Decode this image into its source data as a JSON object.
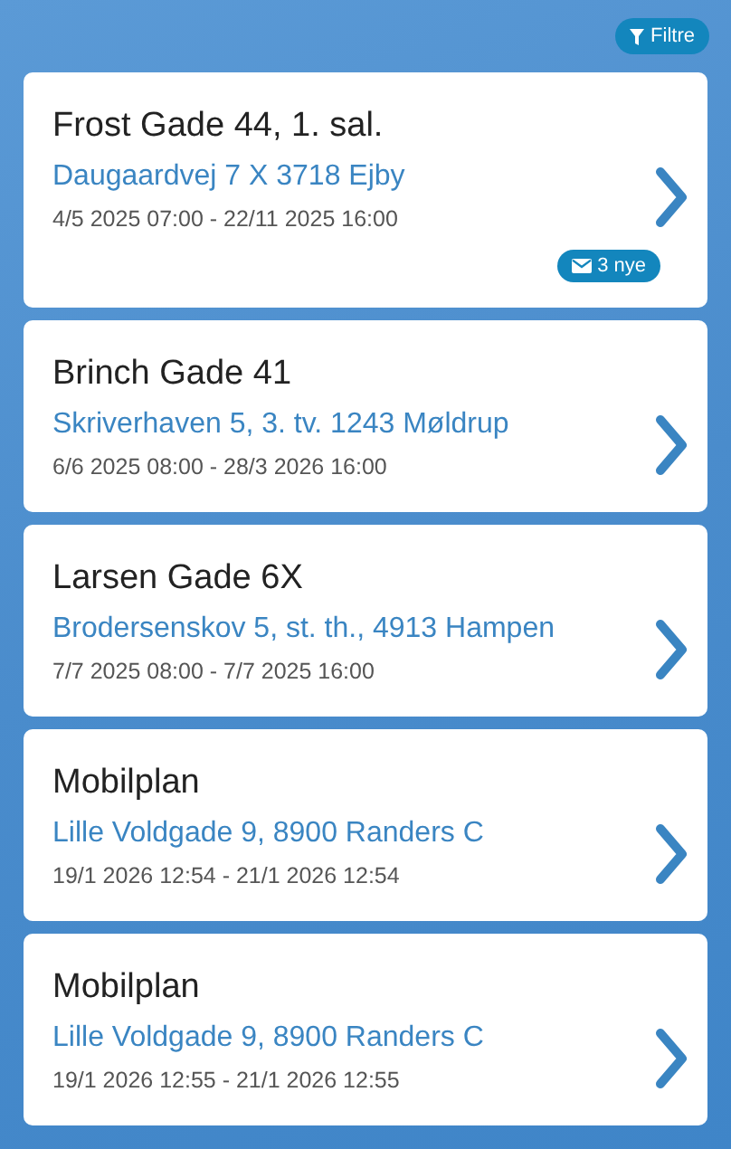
{
  "filter_button": {
    "label": "Filtre"
  },
  "cards": [
    {
      "title": "Frost Gade 44, 1. sal.",
      "address": "Daugaardvej 7 X 3718 Ejby",
      "period": "4/5 2025 07:00 - 22/11 2025 16:00",
      "badge": "3 nye"
    },
    {
      "title": "Brinch Gade 41",
      "address": "Skriverhaven 5, 3. tv. 1243 Møldrup",
      "period": "6/6 2025 08:00 - 28/3 2026 16:00"
    },
    {
      "title": "Larsen Gade 6X",
      "address": "Brodersenskov 5, st. th., 4913 Hampen",
      "period": "7/7 2025 08:00 - 7/7 2025 16:00"
    },
    {
      "title": "Mobilplan",
      "address": "Lille Voldgade 9, 8900 Randers C",
      "period": "19/1 2026 12:54 - 21/1 2026 12:54"
    },
    {
      "title": "Mobilplan",
      "address": "Lille Voldgade 9, 8900 Randers C",
      "period": "19/1 2026 12:55 - 21/1 2026 12:55"
    }
  ]
}
